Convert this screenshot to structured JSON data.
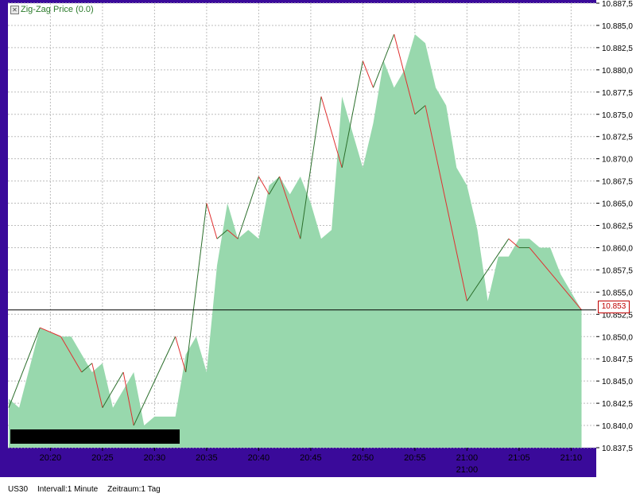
{
  "legend": {
    "label": "Zig-Zag Price (0.0)",
    "checkbox_icon": "close-box-icon"
  },
  "footer": {
    "symbol": "US30",
    "interval": "Intervall:1 Minute",
    "range": "Zeitraum:1 Tag"
  },
  "current_price_label": "10.853",
  "colors": {
    "area": "#98d8ad",
    "up": "#2b6e2b",
    "down": "#e03030",
    "frame": "#3a0a9a",
    "grid": "#bdbdbd"
  },
  "chart_data": {
    "type": "area",
    "x_ticks": [
      "20:20",
      "20:25",
      "20:30",
      "20:35",
      "20:40",
      "20:45",
      "20:50",
      "20:55",
      "21:00",
      "21:05",
      "21:10"
    ],
    "x_sublabel": "21:00",
    "y_ticks": [
      "10.837,5",
      "10.840,0",
      "10.842,5",
      "10.845,0",
      "10.847,5",
      "10.850,0",
      "10.852,5",
      "10.855,0",
      "10.857,5",
      "10.860,0",
      "10.862,5",
      "10.865,0",
      "10.867,5",
      "10.870,0",
      "10.872,5",
      "10.875,0",
      "10.877,5",
      "10.880,0",
      "10.882,5",
      "10.885,0",
      "10.887,5"
    ],
    "ylim": [
      10837.5,
      10887.5
    ],
    "current_price": 10853,
    "x_minutes": [
      0,
      1,
      3,
      5,
      6,
      7,
      8,
      9,
      10,
      11,
      12,
      13,
      14,
      15,
      16,
      17,
      18,
      19,
      20,
      21,
      22,
      23,
      24,
      25,
      26,
      27,
      28,
      29,
      30,
      31,
      32,
      33,
      34,
      35,
      36,
      37,
      38,
      39,
      40,
      41,
      42,
      43,
      44,
      45,
      46,
      47,
      48,
      49,
      50,
      51,
      52,
      53,
      54,
      55
    ],
    "close": [
      10843,
      10842,
      10851,
      10850,
      10850,
      10848,
      10846,
      10847,
      10842,
      10844,
      10846,
      10840,
      10841,
      10841,
      10841,
      10848,
      10850,
      10846,
      10858,
      10865,
      10861,
      10862,
      10861,
      10867,
      10868,
      10866,
      10868,
      10865,
      10861,
      10862,
      10877,
      10873,
      10869,
      10874,
      10881,
      10878,
      10880,
      10884,
      10883,
      10878,
      10876,
      10869,
      10867,
      10862,
      10854,
      10859,
      10859,
      10861,
      10861,
      10860,
      10860,
      10857,
      10855,
      10853
    ],
    "zigzag": [
      [
        0,
        10842
      ],
      [
        3,
        10851
      ],
      [
        5,
        10850
      ],
      [
        7,
        10846
      ],
      [
        8,
        10847
      ],
      [
        9,
        10842
      ],
      [
        11,
        10846
      ],
      [
        12,
        10840
      ],
      [
        16,
        10850
      ],
      [
        17,
        10846
      ],
      [
        19,
        10865
      ],
      [
        20,
        10861
      ],
      [
        21,
        10862
      ],
      [
        22,
        10861
      ],
      [
        24,
        10868
      ],
      [
        25,
        10866
      ],
      [
        26,
        10868
      ],
      [
        28,
        10861
      ],
      [
        30,
        10877
      ],
      [
        32,
        10869
      ],
      [
        34,
        10881
      ],
      [
        35,
        10878
      ],
      [
        37,
        10884
      ],
      [
        39,
        10875
      ],
      [
        40,
        10876
      ],
      [
        44,
        10854
      ],
      [
        48,
        10861
      ],
      [
        49,
        10860
      ],
      [
        50,
        10860
      ],
      [
        55,
        10853
      ]
    ]
  }
}
